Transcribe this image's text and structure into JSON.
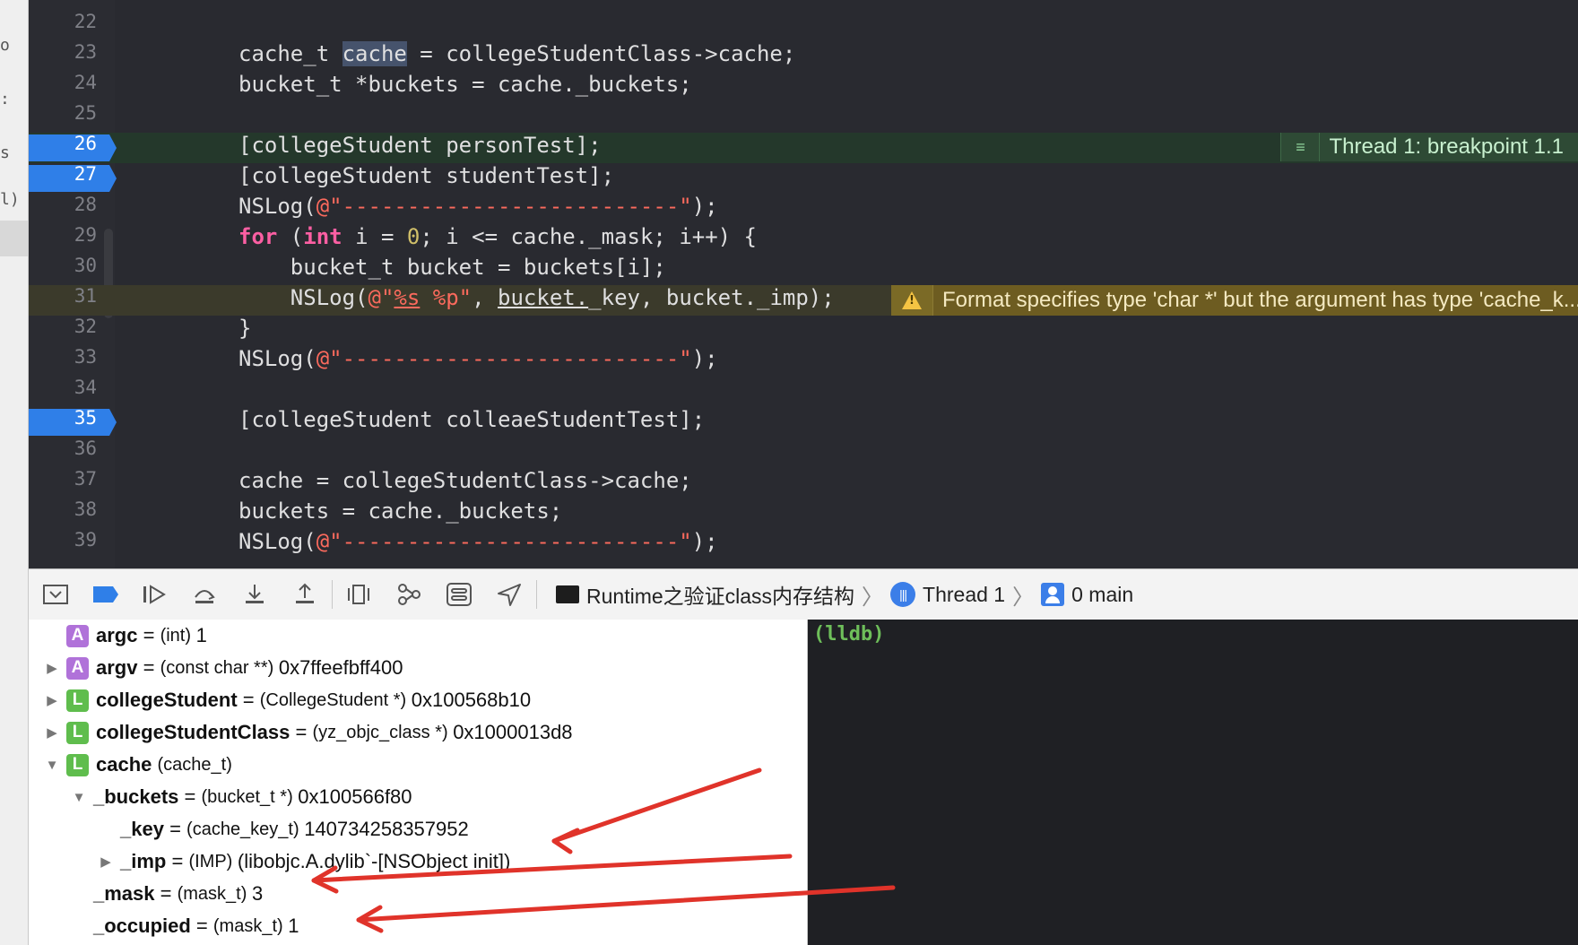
{
  "editor": {
    "lines": [
      {
        "num": "22",
        "code": ""
      },
      {
        "num": "23",
        "code": ""
      },
      {
        "num": "24",
        "code": "bucket_t *buckets = cache._buckets;"
      },
      {
        "num": "25",
        "code": ""
      },
      {
        "num": "26",
        "code": "[collegeStudent personTest];"
      },
      {
        "num": "27",
        "code": "[collegeStudent studentTest];"
      },
      {
        "num": "28",
        "code": ""
      },
      {
        "num": "29",
        "code": ""
      },
      {
        "num": "30",
        "code": "    bucket_t bucket = buckets[i];"
      },
      {
        "num": "31",
        "code": ""
      },
      {
        "num": "32",
        "code": "}"
      },
      {
        "num": "33",
        "code": ""
      },
      {
        "num": "34",
        "code": ""
      },
      {
        "num": "35",
        "code": "[collegeStudent colleaeStudentTest];"
      },
      {
        "num": "36",
        "code": ""
      },
      {
        "num": "37",
        "code": "cache = collegeStudentClass->cache;"
      },
      {
        "num": "38",
        "code": "buckets = cache._buckets;"
      },
      {
        "num": "39",
        "code": ""
      }
    ],
    "line23": {
      "pre": "cache_t ",
      "selected": "cache",
      "post": " = collegeStudentClass->cache;"
    },
    "nslog_open": "NSLog(",
    "nslog_string": "@\"--------------------------\"",
    "nslog_close": ");",
    "for_line": {
      "kw_for": "for",
      "open": " (",
      "kw_int": "int",
      "mid1": " i = ",
      "zero": "0",
      "rest": "; i <= cache._mask; i++) {"
    },
    "line31": {
      "indent": "    NSLog(",
      "str_open": "@\"",
      "fmt1": "%s",
      "str_mid": " %p\"",
      "comma": ", ",
      "arg_u": "bucket.",
      "arg_rest": "_key, bucket._imp);"
    },
    "breakpoint_annotation": "Thread 1: breakpoint 1.1",
    "warning_annotation": "Format specifies type 'char *' but the argument has type 'cache_k..."
  },
  "sidebar": {
    "glyphs": [
      "o",
      ":",
      "s",
      "l)"
    ]
  },
  "debug_bar": {
    "breadcrumb": [
      "Runtime之验证class内存结构",
      "Thread 1",
      "0 main"
    ]
  },
  "variables": [
    {
      "indent": 0,
      "disclosure": "",
      "badge": "A",
      "name": "argc",
      "eq": " = ",
      "type": "(int) ",
      "value": "1"
    },
    {
      "indent": 0,
      "disclosure": "▶",
      "badge": "A",
      "name": "argv",
      "eq": " = ",
      "type": "(const char **) ",
      "value": "0x7ffeefbff400"
    },
    {
      "indent": 0,
      "disclosure": "▶",
      "badge": "L",
      "name": "collegeStudent",
      "eq": " = ",
      "type": "(CollegeStudent *) ",
      "value": "0x100568b10"
    },
    {
      "indent": 0,
      "disclosure": "▶",
      "badge": "L",
      "name": "collegeStudentClass",
      "eq": " = ",
      "type": "(yz_objc_class *) ",
      "value": "0x1000013d8"
    },
    {
      "indent": 0,
      "disclosure": "▼",
      "badge": "L",
      "name": "cache",
      "eq": " ",
      "type": "(cache_t)",
      "value": ""
    },
    {
      "indent": 1,
      "disclosure": "▼",
      "badge": "",
      "name": "_buckets",
      "eq": " = ",
      "type": "(bucket_t *) ",
      "value": "0x100566f80"
    },
    {
      "indent": 2,
      "disclosure": "",
      "badge": "",
      "name": "_key",
      "eq": " = ",
      "type": "(cache_key_t) ",
      "value": "140734258357952"
    },
    {
      "indent": 2,
      "disclosure": "▶",
      "badge": "",
      "name": "_imp",
      "eq": " = ",
      "type": "(IMP) ",
      "value": "(libobjc.A.dylib`-[NSObject init])"
    },
    {
      "indent": 1,
      "disclosure": "",
      "badge": "",
      "name": "_mask",
      "eq": " = ",
      "type": "(mask_t) ",
      "value": "3"
    },
    {
      "indent": 1,
      "disclosure": "",
      "badge": "",
      "name": "_occupied",
      "eq": " = ",
      "type": "(mask_t) ",
      "value": "1"
    }
  ],
  "console": {
    "prompt": "(lldb)"
  },
  "colors": {
    "annotation_arrows": "#e0332a",
    "breakpoint": "#2f7fe8",
    "warning": "#f5c443"
  }
}
